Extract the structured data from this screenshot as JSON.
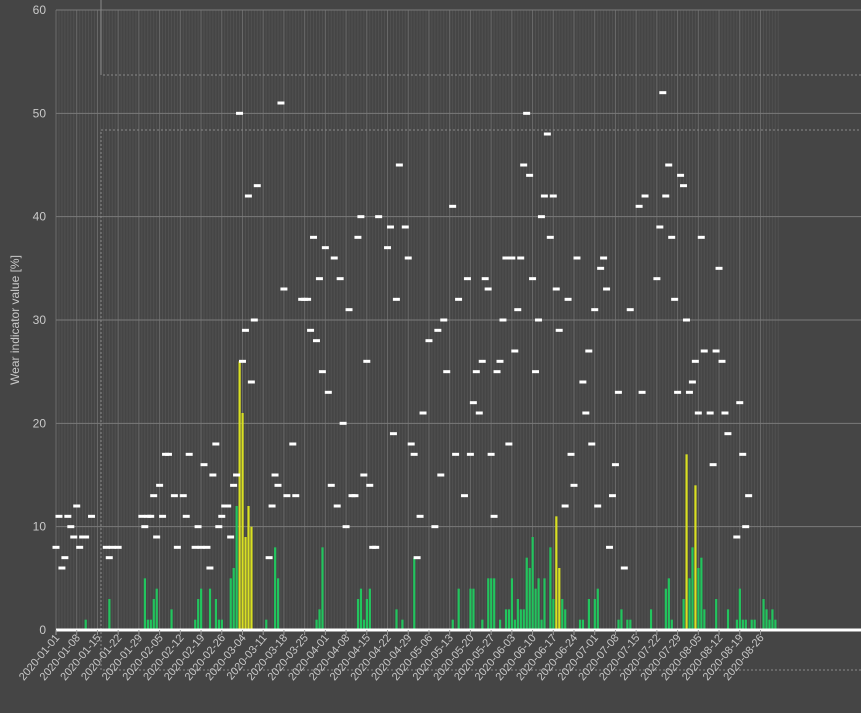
{
  "chart_data": {
    "type": "bar",
    "ylabel": "Wear indicator value [%]",
    "ylim": [
      0,
      60
    ],
    "yticks": [
      0,
      10,
      20,
      30,
      40,
      50,
      60
    ],
    "x_start": "2020-01-01",
    "x_end": "2020-08-23",
    "xtick_labels": [
      "2020-01-01",
      "2020-01-08",
      "2020-01-15",
      "2020-01-22",
      "2020-01-29",
      "2020-02-05",
      "2020-02-12",
      "2020-02-19",
      "2020-02-26",
      "2020-03-04",
      "2020-03-11",
      "2020-03-18",
      "2020-03-25",
      "2020-04-01",
      "2020-04-08",
      "2020-04-15",
      "2020-04-22",
      "2020-04-29",
      "2020-05-06",
      "2020-05-13",
      "2020-05-20",
      "2020-05-27",
      "2020-06-03",
      "2020-06-10",
      "2020-06-17",
      "2020-06-24",
      "2020-07-01",
      "2020-07-08",
      "2020-07-15",
      "2020-07-22",
      "2020-07-29",
      "2020-08-05",
      "2020-08-12",
      "2020-08-19",
      "2020-08-26"
    ],
    "grid": true,
    "colors": {
      "background": "#454545",
      "bar_green": "#22c55e",
      "bar_yellow": "#d9e022",
      "marker": "#ffffff",
      "grid": "#7a7a7a",
      "text": "#c9c9c9"
    },
    "bars": [
      {
        "x": "2020-01-11",
        "y": 1
      },
      {
        "x": "2020-01-19",
        "y": 3
      },
      {
        "x": "2020-01-31",
        "y": 5
      },
      {
        "x": "2020-02-01",
        "y": 1
      },
      {
        "x": "2020-02-02",
        "y": 1
      },
      {
        "x": "2020-02-03",
        "y": 3
      },
      {
        "x": "2020-02-04",
        "y": 4
      },
      {
        "x": "2020-02-09",
        "y": 2
      },
      {
        "x": "2020-02-17",
        "y": 1
      },
      {
        "x": "2020-02-18",
        "y": 3
      },
      {
        "x": "2020-02-19",
        "y": 4
      },
      {
        "x": "2020-02-22",
        "y": 4
      },
      {
        "x": "2020-02-24",
        "y": 3
      },
      {
        "x": "2020-02-25",
        "y": 1
      },
      {
        "x": "2020-02-26",
        "y": 1
      },
      {
        "x": "2020-02-29",
        "y": 5
      },
      {
        "x": "2020-03-01",
        "y": 6
      },
      {
        "x": "2020-03-02",
        "y": 12
      },
      {
        "x": "2020-03-03",
        "y": 26,
        "hi": true
      },
      {
        "x": "2020-03-04",
        "y": 21,
        "hi": true
      },
      {
        "x": "2020-03-05",
        "y": 9,
        "hi": true
      },
      {
        "x": "2020-03-06",
        "y": 12,
        "hi": true
      },
      {
        "x": "2020-03-07",
        "y": 10,
        "hi": true
      },
      {
        "x": "2020-03-12",
        "y": 1
      },
      {
        "x": "2020-03-15",
        "y": 8
      },
      {
        "x": "2020-03-16",
        "y": 5
      },
      {
        "x": "2020-03-29",
        "y": 1
      },
      {
        "x": "2020-03-30",
        "y": 2
      },
      {
        "x": "2020-03-31",
        "y": 8
      },
      {
        "x": "2020-04-12",
        "y": 3
      },
      {
        "x": "2020-04-13",
        "y": 4
      },
      {
        "x": "2020-04-14",
        "y": 1
      },
      {
        "x": "2020-04-15",
        "y": 3
      },
      {
        "x": "2020-04-16",
        "y": 4
      },
      {
        "x": "2020-04-25",
        "y": 2
      },
      {
        "x": "2020-04-27",
        "y": 1
      },
      {
        "x": "2020-05-01",
        "y": 7
      },
      {
        "x": "2020-05-14",
        "y": 1
      },
      {
        "x": "2020-05-16",
        "y": 4
      },
      {
        "x": "2020-05-20",
        "y": 4
      },
      {
        "x": "2020-05-21",
        "y": 4
      },
      {
        "x": "2020-05-24",
        "y": 1
      },
      {
        "x": "2020-05-26",
        "y": 5
      },
      {
        "x": "2020-05-27",
        "y": 5
      },
      {
        "x": "2020-05-28",
        "y": 5
      },
      {
        "x": "2020-05-30",
        "y": 1
      },
      {
        "x": "2020-06-01",
        "y": 2
      },
      {
        "x": "2020-06-02",
        "y": 2
      },
      {
        "x": "2020-06-03",
        "y": 5
      },
      {
        "x": "2020-06-04",
        "y": 1
      },
      {
        "x": "2020-06-05",
        "y": 3
      },
      {
        "x": "2020-06-06",
        "y": 2
      },
      {
        "x": "2020-06-07",
        "y": 2
      },
      {
        "x": "2020-06-08",
        "y": 7
      },
      {
        "x": "2020-06-09",
        "y": 6
      },
      {
        "x": "2020-06-10",
        "y": 9
      },
      {
        "x": "2020-06-11",
        "y": 4
      },
      {
        "x": "2020-06-12",
        "y": 5
      },
      {
        "x": "2020-06-13",
        "y": 1
      },
      {
        "x": "2020-06-14",
        "y": 5
      },
      {
        "x": "2020-06-16",
        "y": 8
      },
      {
        "x": "2020-06-17",
        "y": 3
      },
      {
        "x": "2020-06-18",
        "y": 11,
        "hi": true
      },
      {
        "x": "2020-06-19",
        "y": 6,
        "hi": true
      },
      {
        "x": "2020-06-20",
        "y": 3
      },
      {
        "x": "2020-06-21",
        "y": 2
      },
      {
        "x": "2020-06-26",
        "y": 1
      },
      {
        "x": "2020-06-27",
        "y": 1
      },
      {
        "x": "2020-06-29",
        "y": 3
      },
      {
        "x": "2020-07-01",
        "y": 3
      },
      {
        "x": "2020-07-02",
        "y": 4
      },
      {
        "x": "2020-07-09",
        "y": 1
      },
      {
        "x": "2020-07-10",
        "y": 2
      },
      {
        "x": "2020-07-12",
        "y": 1
      },
      {
        "x": "2020-07-13",
        "y": 1
      },
      {
        "x": "2020-07-20",
        "y": 2
      },
      {
        "x": "2020-07-25",
        "y": 4
      },
      {
        "x": "2020-07-26",
        "y": 5
      },
      {
        "x": "2020-07-27",
        "y": 1
      },
      {
        "x": "2020-07-31",
        "y": 3
      },
      {
        "x": "2020-08-01",
        "y": 17,
        "hi": true
      },
      {
        "x": "2020-08-02",
        "y": 5
      },
      {
        "x": "2020-08-03",
        "y": 8
      },
      {
        "x": "2020-08-04",
        "y": 14,
        "hi": true
      },
      {
        "x": "2020-08-05",
        "y": 6
      },
      {
        "x": "2020-08-06",
        "y": 7
      },
      {
        "x": "2020-08-07",
        "y": 2
      },
      {
        "x": "2020-08-11",
        "y": 3
      },
      {
        "x": "2020-08-15",
        "y": 2
      },
      {
        "x": "2020-08-18",
        "y": 1
      },
      {
        "x": "2020-08-19",
        "y": 4
      },
      {
        "x": "2020-08-20",
        "y": 1
      },
      {
        "x": "2020-08-21",
        "y": 1
      },
      {
        "x": "2020-08-23",
        "y": 1
      },
      {
        "x": "2020-08-24",
        "y": 1
      },
      {
        "x": "2020-08-27",
        "y": 3
      },
      {
        "x": "2020-08-28",
        "y": 2
      },
      {
        "x": "2020-08-29",
        "y": 1
      },
      {
        "x": "2020-08-30",
        "y": 2
      },
      {
        "x": "2020-08-31",
        "y": 1
      }
    ],
    "markers": [
      {
        "x": "2020-01-01",
        "y": 8
      },
      {
        "x": "2020-01-02",
        "y": 11
      },
      {
        "x": "2020-01-03",
        "y": 6
      },
      {
        "x": "2020-01-04",
        "y": 7
      },
      {
        "x": "2020-01-05",
        "y": 11
      },
      {
        "x": "2020-01-06",
        "y": 10
      },
      {
        "x": "2020-01-07",
        "y": 9
      },
      {
        "x": "2020-01-08",
        "y": 12
      },
      {
        "x": "2020-01-09",
        "y": 8
      },
      {
        "x": "2020-01-10",
        "y": 9
      },
      {
        "x": "2020-01-11",
        "y": 9
      },
      {
        "x": "2020-01-13",
        "y": 11
      },
      {
        "x": "2020-01-18",
        "y": 8
      },
      {
        "x": "2020-01-19",
        "y": 7
      },
      {
        "x": "2020-01-20",
        "y": 8
      },
      {
        "x": "2020-01-22",
        "y": 8
      },
      {
        "x": "2020-01-30",
        "y": 11
      },
      {
        "x": "2020-01-31",
        "y": 10
      },
      {
        "x": "2020-02-01",
        "y": 11
      },
      {
        "x": "2020-02-02",
        "y": 11
      },
      {
        "x": "2020-02-03",
        "y": 13
      },
      {
        "x": "2020-02-04",
        "y": 9
      },
      {
        "x": "2020-02-05",
        "y": 14
      },
      {
        "x": "2020-02-06",
        "y": 11
      },
      {
        "x": "2020-02-07",
        "y": 17
      },
      {
        "x": "2020-02-08",
        "y": 17
      },
      {
        "x": "2020-02-10",
        "y": 13
      },
      {
        "x": "2020-02-11",
        "y": 8
      },
      {
        "x": "2020-02-13",
        "y": 13
      },
      {
        "x": "2020-02-14",
        "y": 11
      },
      {
        "x": "2020-02-15",
        "y": 17
      },
      {
        "x": "2020-02-17",
        "y": 8
      },
      {
        "x": "2020-02-18",
        "y": 10
      },
      {
        "x": "2020-02-19",
        "y": 8
      },
      {
        "x": "2020-02-20",
        "y": 16
      },
      {
        "x": "2020-02-21",
        "y": 8
      },
      {
        "x": "2020-02-22",
        "y": 6
      },
      {
        "x": "2020-02-23",
        "y": 15
      },
      {
        "x": "2020-02-24",
        "y": 18
      },
      {
        "x": "2020-02-25",
        "y": 10
      },
      {
        "x": "2020-02-26",
        "y": 11
      },
      {
        "x": "2020-02-27",
        "y": 12
      },
      {
        "x": "2020-02-28",
        "y": 12
      },
      {
        "x": "2020-02-29",
        "y": 9
      },
      {
        "x": "2020-03-01",
        "y": 14
      },
      {
        "x": "2020-03-02",
        "y": 15
      },
      {
        "x": "2020-03-03",
        "y": 50
      },
      {
        "x": "2020-03-04",
        "y": 26
      },
      {
        "x": "2020-03-05",
        "y": 29
      },
      {
        "x": "2020-03-06",
        "y": 42
      },
      {
        "x": "2020-03-07",
        "y": 24
      },
      {
        "x": "2020-03-08",
        "y": 30
      },
      {
        "x": "2020-03-09",
        "y": 43
      },
      {
        "x": "2020-03-13",
        "y": 7
      },
      {
        "x": "2020-03-14",
        "y": 12
      },
      {
        "x": "2020-03-15",
        "y": 15
      },
      {
        "x": "2020-03-16",
        "y": 14
      },
      {
        "x": "2020-03-17",
        "y": 51
      },
      {
        "x": "2020-03-18",
        "y": 33
      },
      {
        "x": "2020-03-19",
        "y": 13
      },
      {
        "x": "2020-03-21",
        "y": 18
      },
      {
        "x": "2020-03-22",
        "y": 13
      },
      {
        "x": "2020-03-24",
        "y": 32
      },
      {
        "x": "2020-03-25",
        "y": 32
      },
      {
        "x": "2020-03-26",
        "y": 32
      },
      {
        "x": "2020-03-27",
        "y": 29
      },
      {
        "x": "2020-03-28",
        "y": 38
      },
      {
        "x": "2020-03-29",
        "y": 28
      },
      {
        "x": "2020-03-30",
        "y": 34
      },
      {
        "x": "2020-03-31",
        "y": 25
      },
      {
        "x": "2020-04-01",
        "y": 37
      },
      {
        "x": "2020-04-02",
        "y": 23
      },
      {
        "x": "2020-04-03",
        "y": 14
      },
      {
        "x": "2020-04-04",
        "y": 36
      },
      {
        "x": "2020-04-05",
        "y": 12
      },
      {
        "x": "2020-04-06",
        "y": 34
      },
      {
        "x": "2020-04-07",
        "y": 20
      },
      {
        "x": "2020-04-08",
        "y": 10
      },
      {
        "x": "2020-04-09",
        "y": 31
      },
      {
        "x": "2020-04-10",
        "y": 13
      },
      {
        "x": "2020-04-11",
        "y": 13
      },
      {
        "x": "2020-04-12",
        "y": 38
      },
      {
        "x": "2020-04-13",
        "y": 40
      },
      {
        "x": "2020-04-14",
        "y": 15
      },
      {
        "x": "2020-04-15",
        "y": 26
      },
      {
        "x": "2020-04-16",
        "y": 14
      },
      {
        "x": "2020-04-17",
        "y": 8
      },
      {
        "x": "2020-04-18",
        "y": 8
      },
      {
        "x": "2020-04-19",
        "y": 40
      },
      {
        "x": "2020-04-22",
        "y": 37
      },
      {
        "x": "2020-04-23",
        "y": 39
      },
      {
        "x": "2020-04-24",
        "y": 19
      },
      {
        "x": "2020-04-25",
        "y": 32
      },
      {
        "x": "2020-04-26",
        "y": 45
      },
      {
        "x": "2020-04-28",
        "y": 39
      },
      {
        "x": "2020-04-29",
        "y": 36
      },
      {
        "x": "2020-04-30",
        "y": 18
      },
      {
        "x": "2020-05-01",
        "y": 17
      },
      {
        "x": "2020-05-02",
        "y": 7
      },
      {
        "x": "2020-05-03",
        "y": 11
      },
      {
        "x": "2020-05-04",
        "y": 21
      },
      {
        "x": "2020-05-06",
        "y": 28
      },
      {
        "x": "2020-05-08",
        "y": 10
      },
      {
        "x": "2020-05-09",
        "y": 29
      },
      {
        "x": "2020-05-10",
        "y": 15
      },
      {
        "x": "2020-05-11",
        "y": 30
      },
      {
        "x": "2020-05-12",
        "y": 25
      },
      {
        "x": "2020-05-14",
        "y": 41
      },
      {
        "x": "2020-05-15",
        "y": 17
      },
      {
        "x": "2020-05-16",
        "y": 32
      },
      {
        "x": "2020-05-18",
        "y": 13
      },
      {
        "x": "2020-05-19",
        "y": 34
      },
      {
        "x": "2020-05-20",
        "y": 17
      },
      {
        "x": "2020-05-21",
        "y": 22
      },
      {
        "x": "2020-05-22",
        "y": 25
      },
      {
        "x": "2020-05-23",
        "y": 21
      },
      {
        "x": "2020-05-24",
        "y": 26
      },
      {
        "x": "2020-05-25",
        "y": 34
      },
      {
        "x": "2020-05-26",
        "y": 33
      },
      {
        "x": "2020-05-27",
        "y": 17
      },
      {
        "x": "2020-05-28",
        "y": 11
      },
      {
        "x": "2020-05-29",
        "y": 25
      },
      {
        "x": "2020-05-30",
        "y": 26
      },
      {
        "x": "2020-05-31",
        "y": 30
      },
      {
        "x": "2020-06-01",
        "y": 36
      },
      {
        "x": "2020-06-02",
        "y": 18
      },
      {
        "x": "2020-06-03",
        "y": 36
      },
      {
        "x": "2020-06-04",
        "y": 27
      },
      {
        "x": "2020-06-05",
        "y": 31
      },
      {
        "x": "2020-06-06",
        "y": 36
      },
      {
        "x": "2020-06-07",
        "y": 45
      },
      {
        "x": "2020-06-08",
        "y": 50
      },
      {
        "x": "2020-06-09",
        "y": 44
      },
      {
        "x": "2020-06-10",
        "y": 34
      },
      {
        "x": "2020-06-11",
        "y": 25
      },
      {
        "x": "2020-06-12",
        "y": 30
      },
      {
        "x": "2020-06-13",
        "y": 40
      },
      {
        "x": "2020-06-14",
        "y": 42
      },
      {
        "x": "2020-06-15",
        "y": 48
      },
      {
        "x": "2020-06-16",
        "y": 38
      },
      {
        "x": "2020-06-17",
        "y": 42
      },
      {
        "x": "2020-06-18",
        "y": 33
      },
      {
        "x": "2020-06-19",
        "y": 29
      },
      {
        "x": "2020-06-21",
        "y": 12
      },
      {
        "x": "2020-06-22",
        "y": 32
      },
      {
        "x": "2020-06-23",
        "y": 17
      },
      {
        "x": "2020-06-24",
        "y": 14
      },
      {
        "x": "2020-06-25",
        "y": 36
      },
      {
        "x": "2020-06-27",
        "y": 24
      },
      {
        "x": "2020-06-28",
        "y": 21
      },
      {
        "x": "2020-06-29",
        "y": 27
      },
      {
        "x": "2020-06-30",
        "y": 18
      },
      {
        "x": "2020-07-01",
        "y": 31
      },
      {
        "x": "2020-07-02",
        "y": 12
      },
      {
        "x": "2020-07-03",
        "y": 35
      },
      {
        "x": "2020-07-04",
        "y": 36
      },
      {
        "x": "2020-07-05",
        "y": 33
      },
      {
        "x": "2020-07-06",
        "y": 8
      },
      {
        "x": "2020-07-07",
        "y": 13
      },
      {
        "x": "2020-07-08",
        "y": 16
      },
      {
        "x": "2020-07-09",
        "y": 23
      },
      {
        "x": "2020-07-11",
        "y": 6
      },
      {
        "x": "2020-07-13",
        "y": 31
      },
      {
        "x": "2020-07-16",
        "y": 41
      },
      {
        "x": "2020-07-17",
        "y": 23
      },
      {
        "x": "2020-07-18",
        "y": 42
      },
      {
        "x": "2020-07-22",
        "y": 34
      },
      {
        "x": "2020-07-23",
        "y": 39
      },
      {
        "x": "2020-07-24",
        "y": 52
      },
      {
        "x": "2020-07-25",
        "y": 42
      },
      {
        "x": "2020-07-26",
        "y": 45
      },
      {
        "x": "2020-07-27",
        "y": 38
      },
      {
        "x": "2020-07-28",
        "y": 32
      },
      {
        "x": "2020-07-29",
        "y": 23
      },
      {
        "x": "2020-07-30",
        "y": 44
      },
      {
        "x": "2020-07-31",
        "y": 43
      },
      {
        "x": "2020-08-01",
        "y": 30
      },
      {
        "x": "2020-08-02",
        "y": 23
      },
      {
        "x": "2020-08-03",
        "y": 24
      },
      {
        "x": "2020-08-04",
        "y": 26
      },
      {
        "x": "2020-08-05",
        "y": 21
      },
      {
        "x": "2020-08-06",
        "y": 38
      },
      {
        "x": "2020-08-07",
        "y": 27
      },
      {
        "x": "2020-08-09",
        "y": 21
      },
      {
        "x": "2020-08-10",
        "y": 16
      },
      {
        "x": "2020-08-11",
        "y": 27
      },
      {
        "x": "2020-08-12",
        "y": 35
      },
      {
        "x": "2020-08-13",
        "y": 26
      },
      {
        "x": "2020-08-14",
        "y": 21
      },
      {
        "x": "2020-08-15",
        "y": 19
      },
      {
        "x": "2020-08-18",
        "y": 9
      },
      {
        "x": "2020-08-19",
        "y": 22
      },
      {
        "x": "2020-08-20",
        "y": 17
      },
      {
        "x": "2020-08-21",
        "y": 10
      },
      {
        "x": "2020-08-22",
        "y": 13
      }
    ]
  }
}
